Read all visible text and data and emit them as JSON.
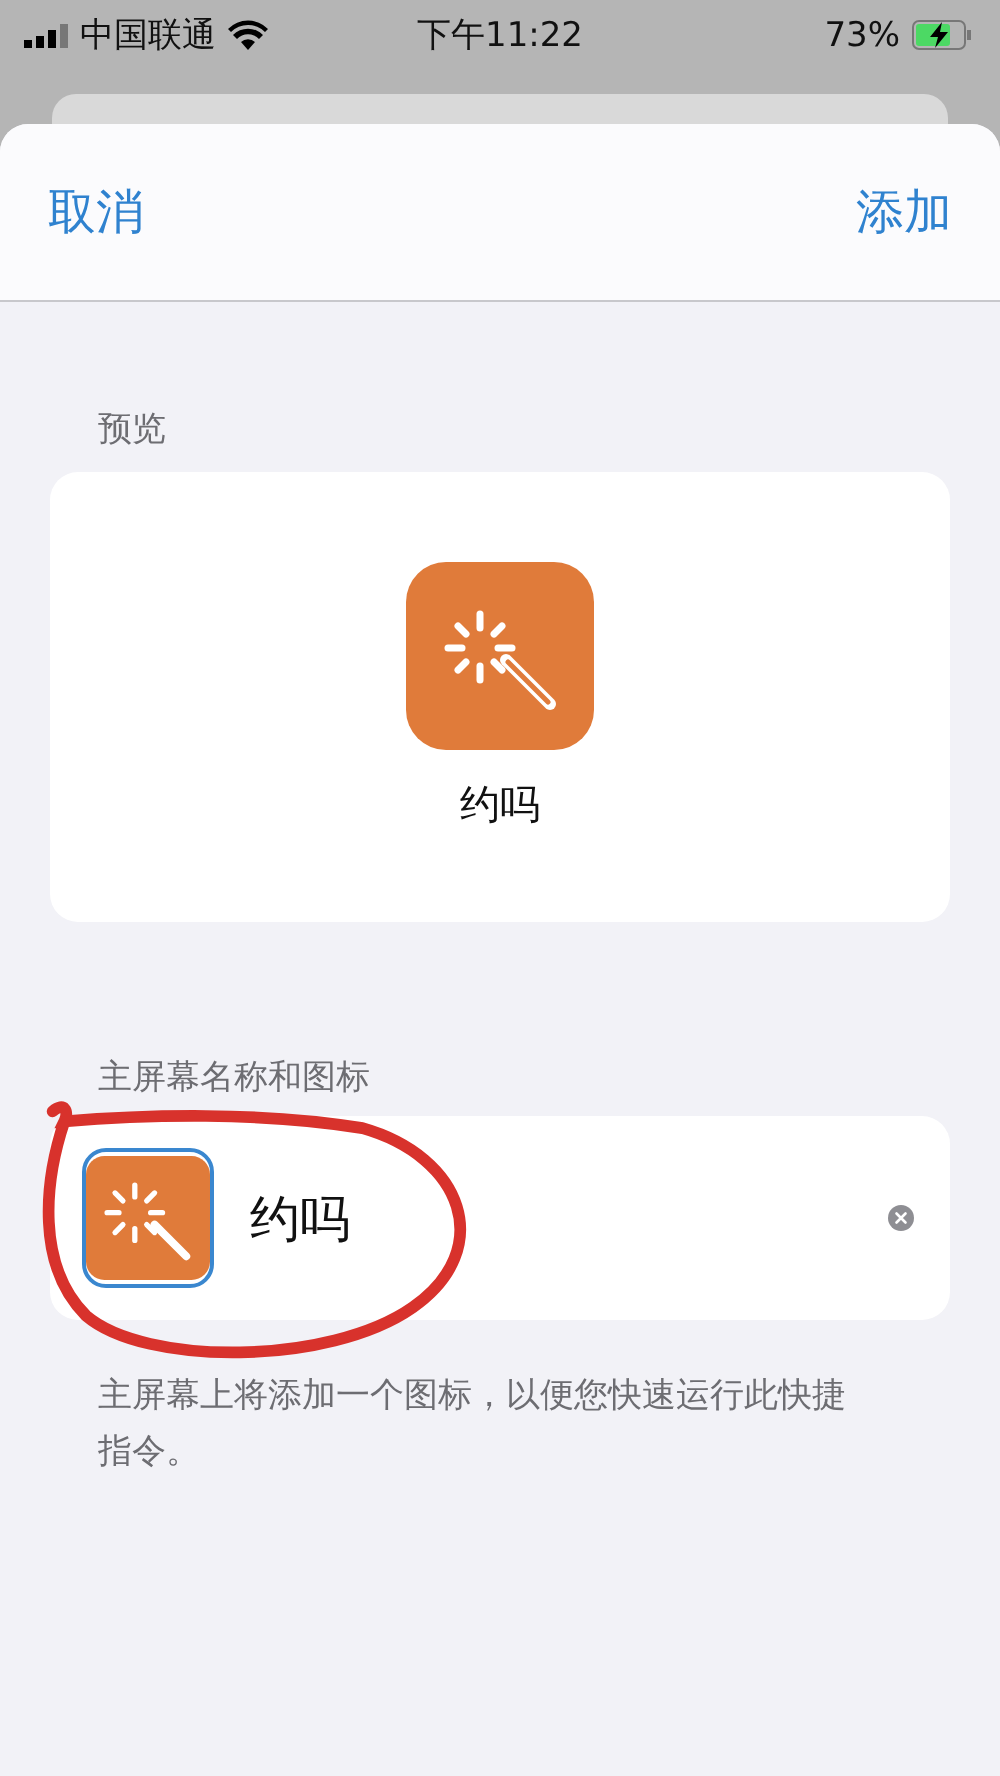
{
  "status_bar": {
    "carrier": "中国联通",
    "time": "下午11:22",
    "battery": "73%",
    "charging": true
  },
  "nav": {
    "cancel": "取消",
    "add": "添加"
  },
  "preview": {
    "label": "预览",
    "name": "约吗"
  },
  "home_screen": {
    "label": "主屏幕名称和图标",
    "name_value": "约吗",
    "footer": "主屏幕上将添加一个图标，以便您快速运行此快捷指令。"
  }
}
